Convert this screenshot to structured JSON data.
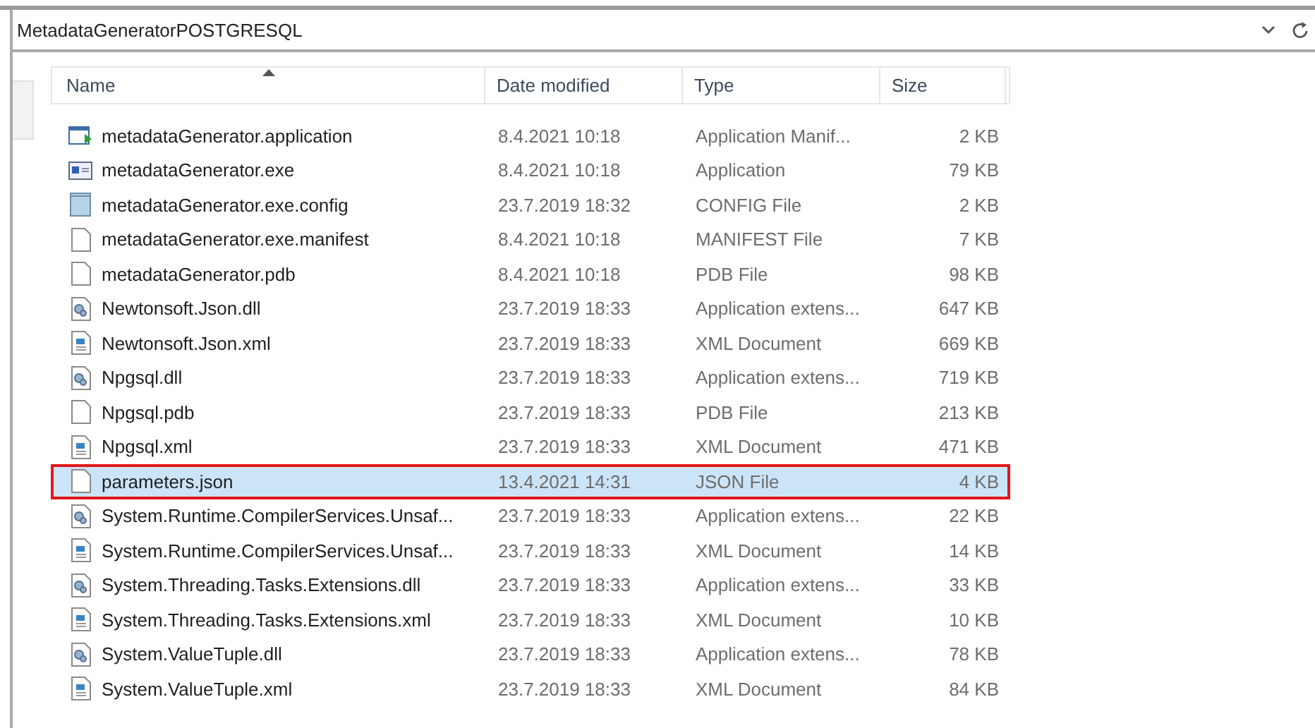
{
  "address_bar": {
    "path": "MetadataGeneratorPOSTGRESQL"
  },
  "columns": [
    {
      "label": "Name",
      "sorted": true
    },
    {
      "label": "Date modified",
      "sorted": false
    },
    {
      "label": "Type",
      "sorted": false
    },
    {
      "label": "Size",
      "sorted": false
    }
  ],
  "files": [
    {
      "kind": "application",
      "name": "metadataGenerator.application",
      "date": "8.4.2021 10:18",
      "type": "Application Manif...",
      "size": "2 KB",
      "selected": false,
      "outlined": false
    },
    {
      "kind": "exe",
      "name": "metadataGenerator.exe",
      "date": "8.4.2021 10:18",
      "type": "Application",
      "size": "79 KB",
      "selected": false,
      "outlined": false
    },
    {
      "kind": "config",
      "name": "metadataGenerator.exe.config",
      "date": "23.7.2019 18:32",
      "type": "CONFIG File",
      "size": "2 KB",
      "selected": false,
      "outlined": false
    },
    {
      "kind": "blank",
      "name": "metadataGenerator.exe.manifest",
      "date": "8.4.2021 10:18",
      "type": "MANIFEST File",
      "size": "7 KB",
      "selected": false,
      "outlined": false
    },
    {
      "kind": "blank",
      "name": "metadataGenerator.pdb",
      "date": "8.4.2021 10:18",
      "type": "PDB File",
      "size": "98 KB",
      "selected": false,
      "outlined": false
    },
    {
      "kind": "dll",
      "name": "Newtonsoft.Json.dll",
      "date": "23.7.2019 18:33",
      "type": "Application extens...",
      "size": "647 KB",
      "selected": false,
      "outlined": false
    },
    {
      "kind": "xml",
      "name": "Newtonsoft.Json.xml",
      "date": "23.7.2019 18:33",
      "type": "XML Document",
      "size": "669 KB",
      "selected": false,
      "outlined": false
    },
    {
      "kind": "dll",
      "name": "Npgsql.dll",
      "date": "23.7.2019 18:33",
      "type": "Application extens...",
      "size": "719 KB",
      "selected": false,
      "outlined": false
    },
    {
      "kind": "blank",
      "name": "Npgsql.pdb",
      "date": "23.7.2019 18:33",
      "type": "PDB File",
      "size": "213 KB",
      "selected": false,
      "outlined": false
    },
    {
      "kind": "xml",
      "name": "Npgsql.xml",
      "date": "23.7.2019 18:33",
      "type": "XML Document",
      "size": "471 KB",
      "selected": false,
      "outlined": false
    },
    {
      "kind": "blank",
      "name": "parameters.json",
      "date": "13.4.2021 14:31",
      "type": "JSON File",
      "size": "4 KB",
      "selected": true,
      "outlined": true
    },
    {
      "kind": "dll",
      "name": "System.Runtime.CompilerServices.Unsaf...",
      "date": "23.7.2019 18:33",
      "type": "Application extens...",
      "size": "22 KB",
      "selected": false,
      "outlined": false
    },
    {
      "kind": "xml",
      "name": "System.Runtime.CompilerServices.Unsaf...",
      "date": "23.7.2019 18:33",
      "type": "XML Document",
      "size": "14 KB",
      "selected": false,
      "outlined": false
    },
    {
      "kind": "dll",
      "name": "System.Threading.Tasks.Extensions.dll",
      "date": "23.7.2019 18:33",
      "type": "Application extens...",
      "size": "33 KB",
      "selected": false,
      "outlined": false
    },
    {
      "kind": "xml",
      "name": "System.Threading.Tasks.Extensions.xml",
      "date": "23.7.2019 18:33",
      "type": "XML Document",
      "size": "10 KB",
      "selected": false,
      "outlined": false
    },
    {
      "kind": "dll",
      "name": "System.ValueTuple.dll",
      "date": "23.7.2019 18:33",
      "type": "Application extens...",
      "size": "78 KB",
      "selected": false,
      "outlined": false
    },
    {
      "kind": "xml",
      "name": "System.ValueTuple.xml",
      "date": "23.7.2019 18:33",
      "type": "XML Document",
      "size": "84 KB",
      "selected": false,
      "outlined": false
    }
  ]
}
